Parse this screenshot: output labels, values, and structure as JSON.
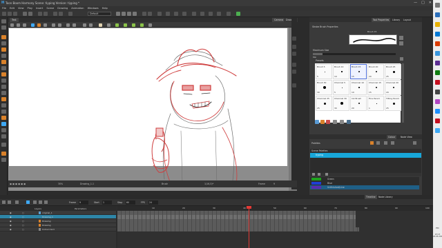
{
  "app": {
    "title": "Toon Boom Harmony Scene: tiyping Version: tiyping *",
    "window_controls": [
      "—",
      "□",
      "✕"
    ]
  },
  "menu": [
    "File",
    "Edit",
    "View",
    "Play",
    "Insert",
    "Scene",
    "Drawing",
    "Animation",
    "Windows",
    "Help"
  ],
  "toolbar": {
    "workspace_select": "Default"
  },
  "camera_view": {
    "tab_label": "Test",
    "tabs": [
      "Camera",
      "Drawing"
    ],
    "status": {
      "zoom": "30%",
      "drawing": "Drawing_1-1",
      "tool": "Brush",
      "coords": "1(16,5)*",
      "frame": "Frame",
      "frame_value": "9"
    }
  },
  "tool_properties": {
    "tabs": [
      "Tool Properties",
      "Library",
      "Layout"
    ],
    "title": "Stroke Brush Properties",
    "brush_label": "Brush 15",
    "max_size_label": "Maximum Size",
    "min_size_label": "Min",
    "max_size_fraction": 0.12,
    "presets_label": "Presets",
    "presets": [
      {
        "name": "Brush 5",
        "size": "5"
      },
      {
        "name": "Brush 10",
        "size": "10"
      },
      {
        "name": "Brush 15",
        "size": "15",
        "selected": true
      },
      {
        "name": "Brush 20",
        "size": "20"
      },
      {
        "name": "Brush 25",
        "size": "25"
      },
      {
        "name": "Brush 30",
        "size": "30"
      },
      {
        "name": "Charcoal 5",
        "size": "5"
      },
      {
        "name": "Charcoal 10",
        "size": "10"
      },
      {
        "name": "Charcoal 15",
        "size": "15"
      },
      {
        "name": "Charcoal 20",
        "size": "20"
      },
      {
        "name": "Charcoal 25",
        "size": "25"
      },
      {
        "name": "Charcoal 30",
        "size": "30"
      },
      {
        "name": "Ink Brush",
        "size": "20"
      },
      {
        "name": "Fine Pencil",
        "size": "1"
      },
      {
        "name": "Tilting Pencil",
        "size": "25"
      }
    ]
  },
  "colour": {
    "tabs": [
      "Colour",
      "Node View"
    ],
    "palettes_label": "Palettes",
    "scene_palettes_label": "Scene Palettes",
    "palette_name": "tiyping",
    "swatches": [
      {
        "name": "Green",
        "color": "#1fa31f"
      },
      {
        "name": "Blue",
        "color": "#1e3fd4"
      },
      {
        "name": "Unfinished/Line",
        "color": "#5a2bb0"
      }
    ]
  },
  "timeline": {
    "tabs": [
      "Timeline",
      "Node Library"
    ],
    "fields": {
      "frame_label": "Frame",
      "frame": "9",
      "start_label": "Start",
      "start": "1",
      "stop_label": "Stop",
      "stop": "60",
      "fps_label": "FPS",
      "fps": "24"
    },
    "layer_header": "Layers",
    "params_header": "Parameters",
    "layers": [
      {
        "name": "original_1",
        "color": "#5aa0d0",
        "selected": false
      },
      {
        "name": "Drawing_1",
        "color": "#2e86a8",
        "selected": true
      },
      {
        "name": "Drawing",
        "color": "#d9822b",
        "selected": false
      },
      {
        "name": "Drawing",
        "color": "#d9822b",
        "selected": false
      },
      {
        "name": "Colour-Card",
        "color": "#888888",
        "selected": false
      }
    ],
    "ruler_ticks": [
      "10",
      "20",
      "30",
      "40",
      "50",
      "60",
      "70",
      "80",
      "90",
      "100"
    ],
    "current_frame": 9
  },
  "system": {
    "tray_lang": "РУС",
    "time": "23:13",
    "date": "20.05.2020"
  },
  "colors": {
    "accent": "#18a7d9",
    "selection_border": "#4e6fd8",
    "sketch_red": "#cf3d3d",
    "playhead": "#e53935"
  }
}
